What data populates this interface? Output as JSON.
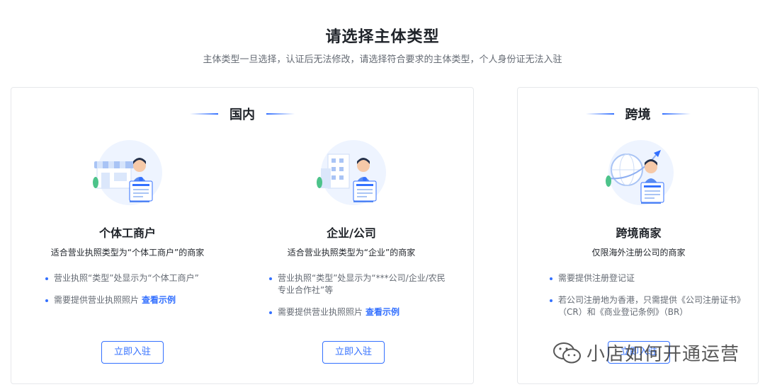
{
  "header": {
    "title": "请选择主体类型",
    "subtitle": "主体类型一旦选择，认证后无法修改，请选择符合要求的主体类型，个人身份证无法入驻"
  },
  "domestic": {
    "title": "国内",
    "options": [
      {
        "name": "个体工商户",
        "desc": "适合营业执照类型为“个体工商户”的商家",
        "req1": "营业执照“类型”处显示为“个体工商户”",
        "req2": "需要提供营业执照照片",
        "link": "查看示例",
        "button": "立即入驻"
      },
      {
        "name": "企业/公司",
        "desc": "适合营业执照类型为“企业”的商家",
        "req1": "营业执照“类型”处显示为“***公司/企业/农民专业合作社”等",
        "req2": "需要提供营业执照照片",
        "link": "查看示例",
        "button": "立即入驻"
      }
    ]
  },
  "cross_border": {
    "title": "跨境",
    "option": {
      "name": "跨境商家",
      "desc": "仅限海外注册公司的商家",
      "req1": "需要提供注册登记证",
      "req2": "若公司注册地为香港，只需提供《公司注册证书》（CR）和《商业登记条例》（BR）",
      "button": "立即入驻"
    }
  },
  "watermark": {
    "text": "小店如何开通运营",
    "icon": "wechat-icon"
  },
  "colors": {
    "accent": "#3370ff",
    "text_primary": "#1f2329",
    "text_secondary": "#646a73",
    "border": "#e6e8eb"
  }
}
